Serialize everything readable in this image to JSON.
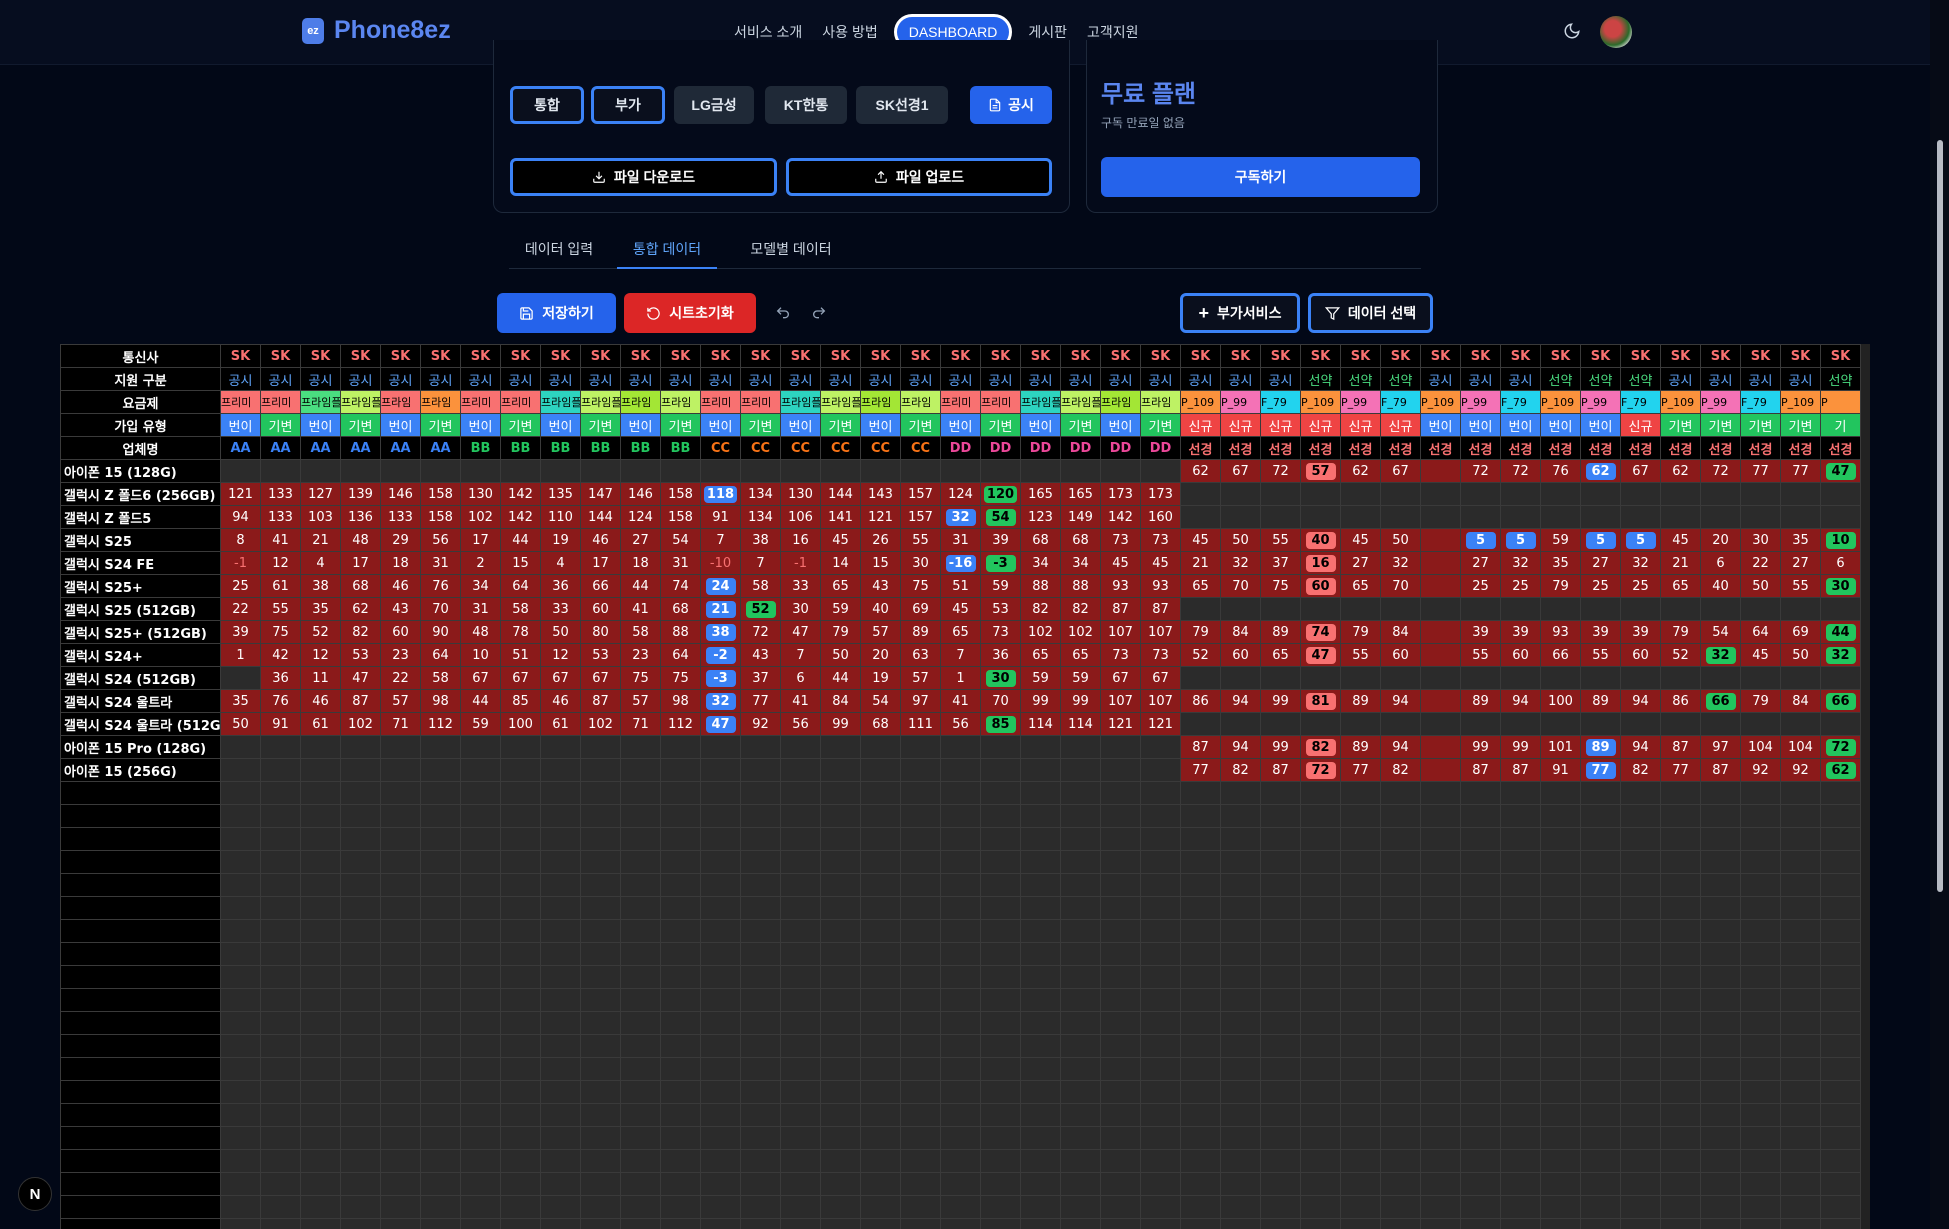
{
  "nav": {
    "logo_icon": "ez",
    "brand": "Phone8ez",
    "menu": [
      "서비스 소개",
      "사용 방법",
      "DASHBOARD",
      "게시판",
      "고객지원"
    ]
  },
  "panel": {
    "chips": [
      "통합",
      "부가",
      "LG금성",
      "KT한통",
      "SK선경1",
      "공시"
    ],
    "download": "파일 다운로드",
    "upload": "파일 업로드"
  },
  "plan": {
    "title": "무료 플랜",
    "subtitle": "구독 만료일 없음",
    "subscribe": "구독하기"
  },
  "tabs": [
    "데이터 입력",
    "통합 데이터",
    "모델별 데이터"
  ],
  "actions": {
    "save": "저장하기",
    "reset": "시트초기화",
    "addon": "부가서비스",
    "select": "데이터 선택"
  },
  "colors": {
    "accent": "#2563eb",
    "reset": "#dc2626",
    "plan_price_red": "#8b1a1a",
    "badge_blue": "#3b82f6",
    "badge_green": "#22c55e",
    "badge_red": "#f87171"
  },
  "sheet": {
    "row_labels": [
      "통신사",
      "지원 구분",
      "요금제",
      "가입 유형",
      "업체명"
    ],
    "carrier": "SK",
    "support": [
      "공시",
      "공시",
      "공시",
      "공시",
      "공시",
      "공시",
      "공시",
      "공시",
      "공시",
      "공시",
      "공시",
      "공시",
      "공시",
      "공시",
      "공시",
      "공시",
      "공시",
      "공시",
      "공시",
      "공시",
      "공시",
      "공시",
      "공시",
      "공시",
      "공시",
      "공시",
      "공시",
      "선약",
      "선약",
      "선약",
      "공시",
      "공시",
      "공시",
      "선약",
      "선약",
      "선약",
      "공시",
      "공시",
      "공시",
      "공시",
      "선약"
    ],
    "plans": [
      "프리미",
      "프리미",
      "프라임플",
      "프라임플",
      "프라임",
      "프라임",
      "프리미",
      "프리미",
      "프라임플",
      "프라임플",
      "프라임",
      "프라임",
      "프리미",
      "프리미",
      "프라임플",
      "프라임플",
      "프라임",
      "프라임",
      "프리미",
      "프리미",
      "프라임플",
      "프라임플",
      "프라임",
      "프라임",
      "P_109",
      "P_99",
      "F_79",
      "P_109",
      "P_99",
      "F_79",
      "P_109",
      "P_99",
      "F_79",
      "P_109",
      "P_99",
      "F_79",
      "P_109",
      "P_99",
      "F_79",
      "P_109",
      "P"
    ],
    "plan_colors": [
      "#f87171",
      "#f87171",
      "#4ade80",
      "#bef264",
      "#f87171",
      "#fb923c",
      "#f87171",
      "#f87171",
      "#2dd4bf",
      "#bef264",
      "#a3e635",
      "#bef264",
      "#f87171",
      "#f87171",
      "#2dd4bf",
      "#bef264",
      "#a3e635",
      "#bef264",
      "#f87171",
      "#f87171",
      "#2dd4bf",
      "#bef264",
      "#a3e635",
      "#bef264",
      "#fb923c",
      "#f472b6",
      "#22d3ee",
      "#fb923c",
      "#f472b6",
      "#22d3ee",
      "#fb923c",
      "#f472b6",
      "#22d3ee",
      "#fb923c",
      "#f472b6",
      "#22d3ee",
      "#fb923c",
      "#f472b6",
      "#22d3ee",
      "#fb923c",
      "#fb923c"
    ],
    "join": [
      "번이",
      "기변",
      "번이",
      "기변",
      "번이",
      "기변",
      "번이",
      "기변",
      "번이",
      "기변",
      "번이",
      "기변",
      "번이",
      "기변",
      "번이",
      "기변",
      "번이",
      "기변",
      "번이",
      "기변",
      "번이",
      "기변",
      "번이",
      "기변",
      "신규",
      "신규",
      "신규",
      "신규",
      "신규",
      "신규",
      "번이",
      "번이",
      "번이",
      "번이",
      "번이",
      "신규",
      "기변",
      "기변",
      "기변",
      "기변",
      "기"
    ],
    "join_colors": [
      "#3b82f6",
      "#22c55e",
      "#3b82f6",
      "#22c55e",
      "#3b82f6",
      "#22c55e",
      "#3b82f6",
      "#22c55e",
      "#3b82f6",
      "#22c55e",
      "#3b82f6",
      "#22c55e",
      "#3b82f6",
      "#22c55e",
      "#3b82f6",
      "#22c55e",
      "#3b82f6",
      "#22c55e",
      "#3b82f6",
      "#22c55e",
      "#3b82f6",
      "#22c55e",
      "#3b82f6",
      "#22c55e",
      "#ef4444",
      "#ef4444",
      "#ef4444",
      "#ef4444",
      "#ef4444",
      "#ef4444",
      "#3b82f6",
      "#3b82f6",
      "#3b82f6",
      "#3b82f6",
      "#3b82f6",
      "#ef4444",
      "#22c55e",
      "#22c55e",
      "#22c55e",
      "#22c55e",
      "#22c55e"
    ],
    "biz": [
      "AA",
      "AA",
      "AA",
      "AA",
      "AA",
      "AA",
      "BB",
      "BB",
      "BB",
      "BB",
      "BB",
      "BB",
      "CC",
      "CC",
      "CC",
      "CC",
      "CC",
      "CC",
      "DD",
      "DD",
      "DD",
      "DD",
      "DD",
      "DD",
      "선경",
      "선경",
      "선경",
      "선경",
      "선경",
      "선경",
      "선경",
      "선경",
      "선경",
      "선경",
      "선경",
      "선경",
      "선경",
      "선경",
      "선경",
      "선경",
      "선경"
    ],
    "biz_colors": {
      "AA": "#3b82f6",
      "BB": "#22c55e",
      "CC": "#f97316",
      "DD": "#ec4899",
      "선경": "#f87171"
    },
    "rows": [
      {
        "model": "아이폰 15 (128G)",
        "v": [
          "",
          "",
          "",
          "",
          "",
          "",
          "",
          "",
          "",
          "",
          "",
          "",
          "",
          "",
          "",
          "",
          "",
          "",
          "",
          "",
          "",
          "",
          "",
          "",
          "62",
          "67",
          "72",
          "57",
          "62",
          "67",
          "",
          "72",
          "72",
          "76",
          "62",
          "67",
          "62",
          "72",
          "77",
          "77",
          "47"
        ]
      },
      {
        "model": "갤럭시 Z 폴드6 (256GB)",
        "v": [
          "121",
          "133",
          "127",
          "139",
          "146",
          "158",
          "130",
          "142",
          "135",
          "147",
          "146",
          "158",
          "118",
          "134",
          "130",
          "144",
          "143",
          "157",
          "124",
          "120",
          "165",
          "165",
          "173",
          "173",
          "",
          "",
          "",
          "",
          "",
          "",
          "",
          "",
          "",
          "",
          "",
          "",
          "",
          "",
          "",
          "",
          ""
        ]
      },
      {
        "model": "갤럭시 Z 폴드5",
        "v": [
          "94",
          "133",
          "103",
          "136",
          "133",
          "158",
          "102",
          "142",
          "110",
          "144",
          "124",
          "158",
          "91",
          "134",
          "106",
          "141",
          "121",
          "157",
          "32",
          "54",
          "123",
          "149",
          "142",
          "160",
          "",
          "",
          "",
          "",
          "",
          "",
          "",
          "",
          "",
          "",
          "",
          "",
          "",
          "",
          "",
          "",
          ""
        ]
      },
      {
        "model": "갤럭시 S25",
        "v": [
          "8",
          "41",
          "21",
          "48",
          "29",
          "56",
          "17",
          "44",
          "19",
          "46",
          "27",
          "54",
          "7",
          "38",
          "16",
          "45",
          "26",
          "55",
          "31",
          "39",
          "68",
          "68",
          "73",
          "73",
          "45",
          "50",
          "55",
          "40",
          "45",
          "50",
          "",
          "5",
          "5",
          "59",
          "5",
          "5",
          "45",
          "20",
          "30",
          "35",
          "10"
        ]
      },
      {
        "model": "갤럭시 S24 FE",
        "v": [
          "-1",
          "12",
          "4",
          "17",
          "18",
          "31",
          "2",
          "15",
          "4",
          "17",
          "18",
          "31",
          "-10",
          "7",
          "-1",
          "14",
          "15",
          "30",
          "-16",
          "-3",
          "34",
          "34",
          "45",
          "45",
          "21",
          "32",
          "37",
          "16",
          "27",
          "32",
          "",
          "27",
          "32",
          "35",
          "27",
          "32",
          "21",
          "6",
          "22",
          "27",
          "6"
        ]
      },
      {
        "model": "갤럭시 S25+",
        "v": [
          "25",
          "61",
          "38",
          "68",
          "46",
          "76",
          "34",
          "64",
          "36",
          "66",
          "44",
          "74",
          "24",
          "58",
          "33",
          "65",
          "43",
          "75",
          "51",
          "59",
          "88",
          "88",
          "93",
          "93",
          "65",
          "70",
          "75",
          "60",
          "65",
          "70",
          "",
          "25",
          "25",
          "79",
          "25",
          "25",
          "65",
          "40",
          "50",
          "55",
          "30"
        ]
      },
      {
        "model": "갤럭시 S25 (512GB)",
        "v": [
          "22",
          "55",
          "35",
          "62",
          "43",
          "70",
          "31",
          "58",
          "33",
          "60",
          "41",
          "68",
          "21",
          "52",
          "30",
          "59",
          "40",
          "69",
          "45",
          "53",
          "82",
          "82",
          "87",
          "87",
          "",
          "",
          "",
          "",
          "",
          "",
          "",
          "",
          "",
          "",
          "",
          "",
          "",
          "",
          "",
          "",
          ""
        ]
      },
      {
        "model": "갤럭시 S25+ (512GB)",
        "v": [
          "39",
          "75",
          "52",
          "82",
          "60",
          "90",
          "48",
          "78",
          "50",
          "80",
          "58",
          "88",
          "38",
          "72",
          "47",
          "79",
          "57",
          "89",
          "65",
          "73",
          "102",
          "102",
          "107",
          "107",
          "79",
          "84",
          "89",
          "74",
          "79",
          "84",
          "",
          "39",
          "39",
          "93",
          "39",
          "39",
          "79",
          "54",
          "64",
          "69",
          "44"
        ]
      },
      {
        "model": "갤럭시 S24+",
        "v": [
          "1",
          "42",
          "12",
          "53",
          "23",
          "64",
          "10",
          "51",
          "12",
          "53",
          "23",
          "64",
          "-2",
          "43",
          "7",
          "50",
          "20",
          "63",
          "7",
          "36",
          "65",
          "65",
          "73",
          "73",
          "52",
          "60",
          "65",
          "47",
          "55",
          "60",
          "",
          "55",
          "60",
          "66",
          "55",
          "60",
          "52",
          "32",
          "45",
          "50",
          "32"
        ]
      },
      {
        "model": "갤럭시 S24 (512GB)",
        "v": [
          "",
          "36",
          "11",
          "47",
          "22",
          "58",
          "67",
          "67",
          "67",
          "67",
          "75",
          "75",
          "-3",
          "37",
          "6",
          "44",
          "19",
          "57",
          "1",
          "30",
          "59",
          "59",
          "67",
          "67",
          "",
          "",
          "",
          "",
          "",
          "",
          "",
          "",
          "",
          "",
          "",
          "",
          "",
          "",
          "",
          "",
          ""
        ]
      },
      {
        "model": "갤럭시 S24 울트라",
        "v": [
          "35",
          "76",
          "46",
          "87",
          "57",
          "98",
          "44",
          "85",
          "46",
          "87",
          "57",
          "98",
          "32",
          "77",
          "41",
          "84",
          "54",
          "97",
          "41",
          "70",
          "99",
          "99",
          "107",
          "107",
          "86",
          "94",
          "99",
          "81",
          "89",
          "94",
          "",
          "89",
          "94",
          "100",
          "89",
          "94",
          "86",
          "66",
          "79",
          "84",
          "66"
        ]
      },
      {
        "model": "갤럭시 S24 울트라 (512G",
        "v": [
          "50",
          "91",
          "61",
          "102",
          "71",
          "112",
          "59",
          "100",
          "61",
          "102",
          "71",
          "112",
          "47",
          "92",
          "56",
          "99",
          "68",
          "111",
          "56",
          "85",
          "114",
          "114",
          "121",
          "121",
          "",
          "",
          "",
          "",
          "",
          "",
          "",
          "",
          "",
          "",
          "",
          "",
          "",
          "",
          "",
          "",
          ""
        ]
      },
      {
        "model": "아이폰 15 Pro (128G)",
        "v": [
          "",
          "",
          "",
          "",
          "",
          "",
          "",
          "",
          "",
          "",
          "",
          "",
          "",
          "",
          "",
          "",
          "",
          "",
          "",
          "",
          "",
          "",
          "",
          "",
          "87",
          "94",
          "99",
          "82",
          "89",
          "94",
          "",
          "99",
          "99",
          "101",
          "89",
          "94",
          "87",
          "97",
          "104",
          "104",
          "72"
        ]
      },
      {
        "model": "아이폰 15 (256G)",
        "v": [
          "",
          "",
          "",
          "",
          "",
          "",
          "",
          "",
          "",
          "",
          "",
          "",
          "",
          "",
          "",
          "",
          "",
          "",
          "",
          "",
          "",
          "",
          "",
          "",
          "77",
          "82",
          "87",
          "72",
          "77",
          "82",
          "",
          "87",
          "87",
          "91",
          "77",
          "82",
          "77",
          "87",
          "92",
          "92",
          "62"
        ]
      }
    ],
    "badges": {
      "blue": [
        "1-12",
        "2-18",
        "3-31",
        "4-18",
        "5-12",
        "6-12",
        "7-12",
        "8-12",
        "9-12",
        "10-12",
        "11-12",
        "3-31",
        "3-32",
        "3-34",
        "3-35",
        "0-34",
        "12-34",
        "13-34"
      ],
      "green": [
        "1-19",
        "2-19",
        "4-19",
        "6-13",
        "9-19",
        "11-19",
        "0-40",
        "3-40",
        "5-40",
        "7-40",
        "8-37",
        "8-40",
        "10-37",
        "10-40",
        "12-40",
        "13-40"
      ],
      "red": [
        "0-27",
        "3-27",
        "4-27",
        "5-27",
        "7-27",
        "8-27",
        "10-27",
        "12-27",
        "13-27"
      ]
    }
  }
}
